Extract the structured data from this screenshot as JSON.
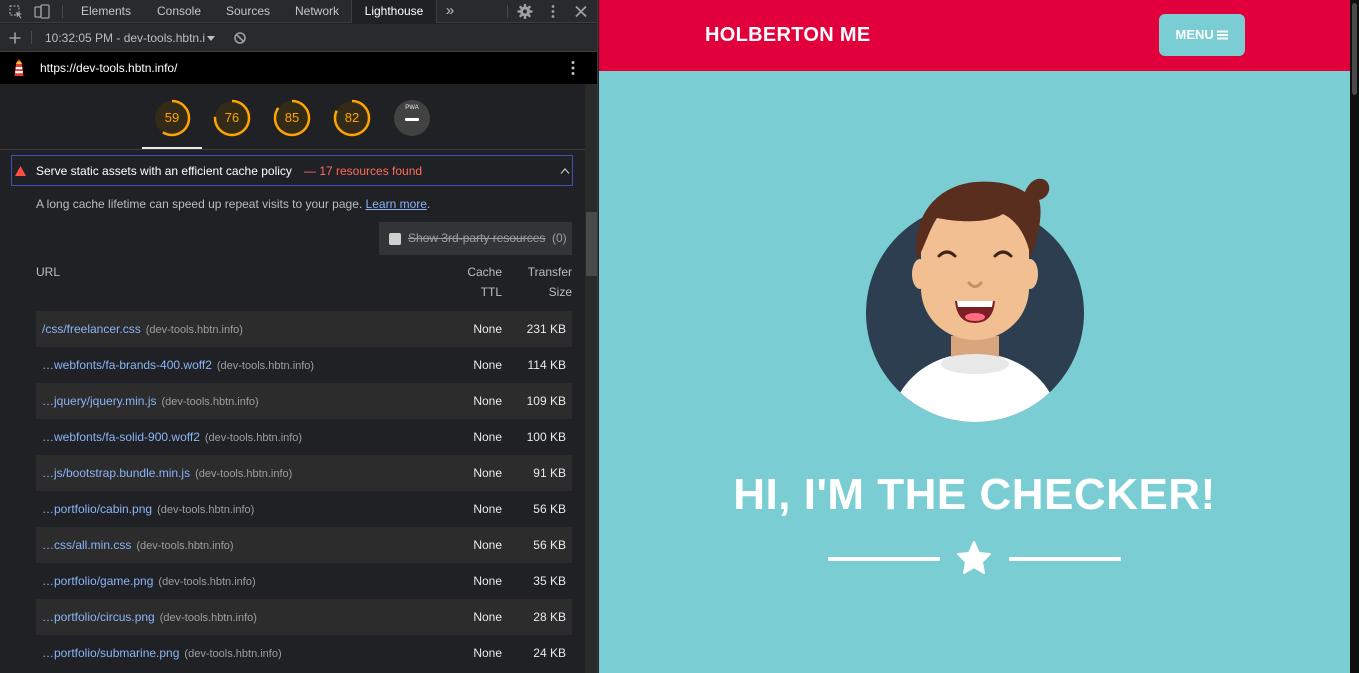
{
  "devtools": {
    "tabs": [
      "Elements",
      "Console",
      "Sources",
      "Network",
      "Lighthouse"
    ],
    "active_tab": "Lighthouse",
    "toolbar": {
      "report_label": "10:32:05 PM - dev-tools.hbtn.i"
    },
    "report_url": "https://dev-tools.hbtn.info/",
    "scores": [
      "59",
      "76",
      "85",
      "82"
    ],
    "score_fractions": [
      0.59,
      0.76,
      0.85,
      0.82
    ],
    "pwa_label": "PWA",
    "colors": {
      "average": "#ffa400",
      "fail": "#ff4e42",
      "link": "#8ab4f8"
    },
    "audit": {
      "title": "Serve static assets with an efficient cache policy",
      "found": "— 17 resources found",
      "description": "A long cache lifetime can speed up repeat visits to your page.",
      "learn_more": "Learn more",
      "desc_end": ".",
      "third_party_label": "Show 3rd-party resources",
      "third_party_count": "(0)",
      "columns": {
        "url": "URL",
        "ttl_1": "Cache",
        "ttl_2": "TTL",
        "size_1": "Transfer",
        "size_2": "Size"
      },
      "rows": [
        {
          "url": "/css/freelancer.css",
          "host": "(dev-tools.hbtn.info)",
          "ttl": "None",
          "size": "231 KB"
        },
        {
          "url": "…webfonts/fa-brands-400.woff2",
          "host": "(dev-tools.hbtn.info)",
          "ttl": "None",
          "size": "114 KB"
        },
        {
          "url": "…jquery/jquery.min.js",
          "host": "(dev-tools.hbtn.info)",
          "ttl": "None",
          "size": "109 KB"
        },
        {
          "url": "…webfonts/fa-solid-900.woff2",
          "host": "(dev-tools.hbtn.info)",
          "ttl": "None",
          "size": "100 KB"
        },
        {
          "url": "…js/bootstrap.bundle.min.js",
          "host": "(dev-tools.hbtn.info)",
          "ttl": "None",
          "size": "91 KB"
        },
        {
          "url": "…portfolio/cabin.png",
          "host": "(dev-tools.hbtn.info)",
          "ttl": "None",
          "size": "56 KB"
        },
        {
          "url": "…css/all.min.css",
          "host": "(dev-tools.hbtn.info)",
          "ttl": "None",
          "size": "56 KB"
        },
        {
          "url": "…portfolio/game.png",
          "host": "(dev-tools.hbtn.info)",
          "ttl": "None",
          "size": "35 KB"
        },
        {
          "url": "…portfolio/circus.png",
          "host": "(dev-tools.hbtn.info)",
          "ttl": "None",
          "size": "28 KB"
        },
        {
          "url": "…portfolio/submarine.png",
          "host": "(dev-tools.hbtn.info)",
          "ttl": "None",
          "size": "24 KB"
        }
      ]
    }
  },
  "site": {
    "brand": "HOLBERTON ME",
    "menu_label": "MENU",
    "headline": "HI, I'M THE CHECKER!",
    "colors": {
      "navbar": "#e2003c",
      "background": "#7acdd2",
      "text": "#ffffff"
    }
  }
}
